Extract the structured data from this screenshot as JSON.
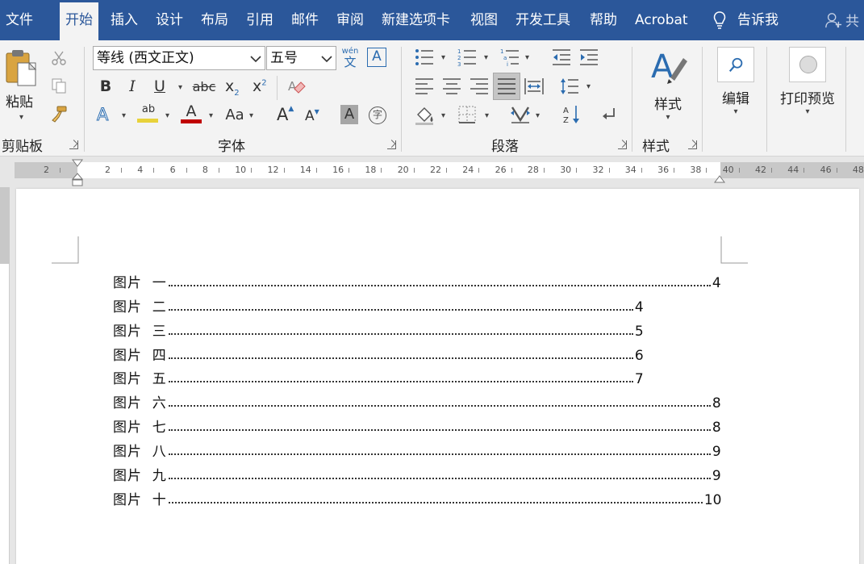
{
  "menu": {
    "tabs": [
      "文件",
      "开始",
      "插入",
      "设计",
      "布局",
      "引用",
      "邮件",
      "审阅",
      "新建选项卡",
      "视图",
      "开发工具",
      "帮助",
      "Acrobat"
    ],
    "active_tab": "开始",
    "tell_me": "告诉我",
    "share": "共"
  },
  "ribbon": {
    "clipboard": {
      "paste": "粘贴",
      "label": "剪贴板"
    },
    "font": {
      "font_name": "等线 (西文正文)",
      "font_size": "五号",
      "phonetic_top": "wén",
      "phonetic_bottom": "文",
      "label": "字体"
    },
    "paragraph": {
      "label": "段落"
    },
    "styles": {
      "button": "样式",
      "label": "样式"
    },
    "editing": {
      "button": "编辑"
    },
    "print_preview": {
      "button": "打印预览"
    }
  },
  "ruler": {
    "labels": [
      "2",
      "2",
      "4",
      "6",
      "8",
      "10",
      "12",
      "14",
      "16",
      "18",
      "20",
      "22",
      "24",
      "26",
      "28",
      "30",
      "32",
      "34",
      "36",
      "38",
      "40",
      "42",
      "44",
      "46",
      "48"
    ]
  },
  "document": {
    "toc": [
      {
        "label": "图片  一",
        "page": "4"
      },
      {
        "label": "图片  二",
        "page": "4"
      },
      {
        "label": "图片  三",
        "page": "5"
      },
      {
        "label": "图片  四",
        "page": "6"
      },
      {
        "label": "图片  五",
        "page": "7"
      },
      {
        "label": "图片  六",
        "page": "8"
      },
      {
        "label": "图片  七",
        "page": "8"
      },
      {
        "label": "图片  八",
        "page": "9"
      },
      {
        "label": "图片  九",
        "page": "9"
      },
      {
        "label": "图片  十",
        "page": "10"
      }
    ]
  },
  "colors": {
    "accent": "#2b579a",
    "ribbon_bg": "#f3f3f3",
    "font_color_bar": "#c00000",
    "highlight_bar": "#e8d23a"
  }
}
